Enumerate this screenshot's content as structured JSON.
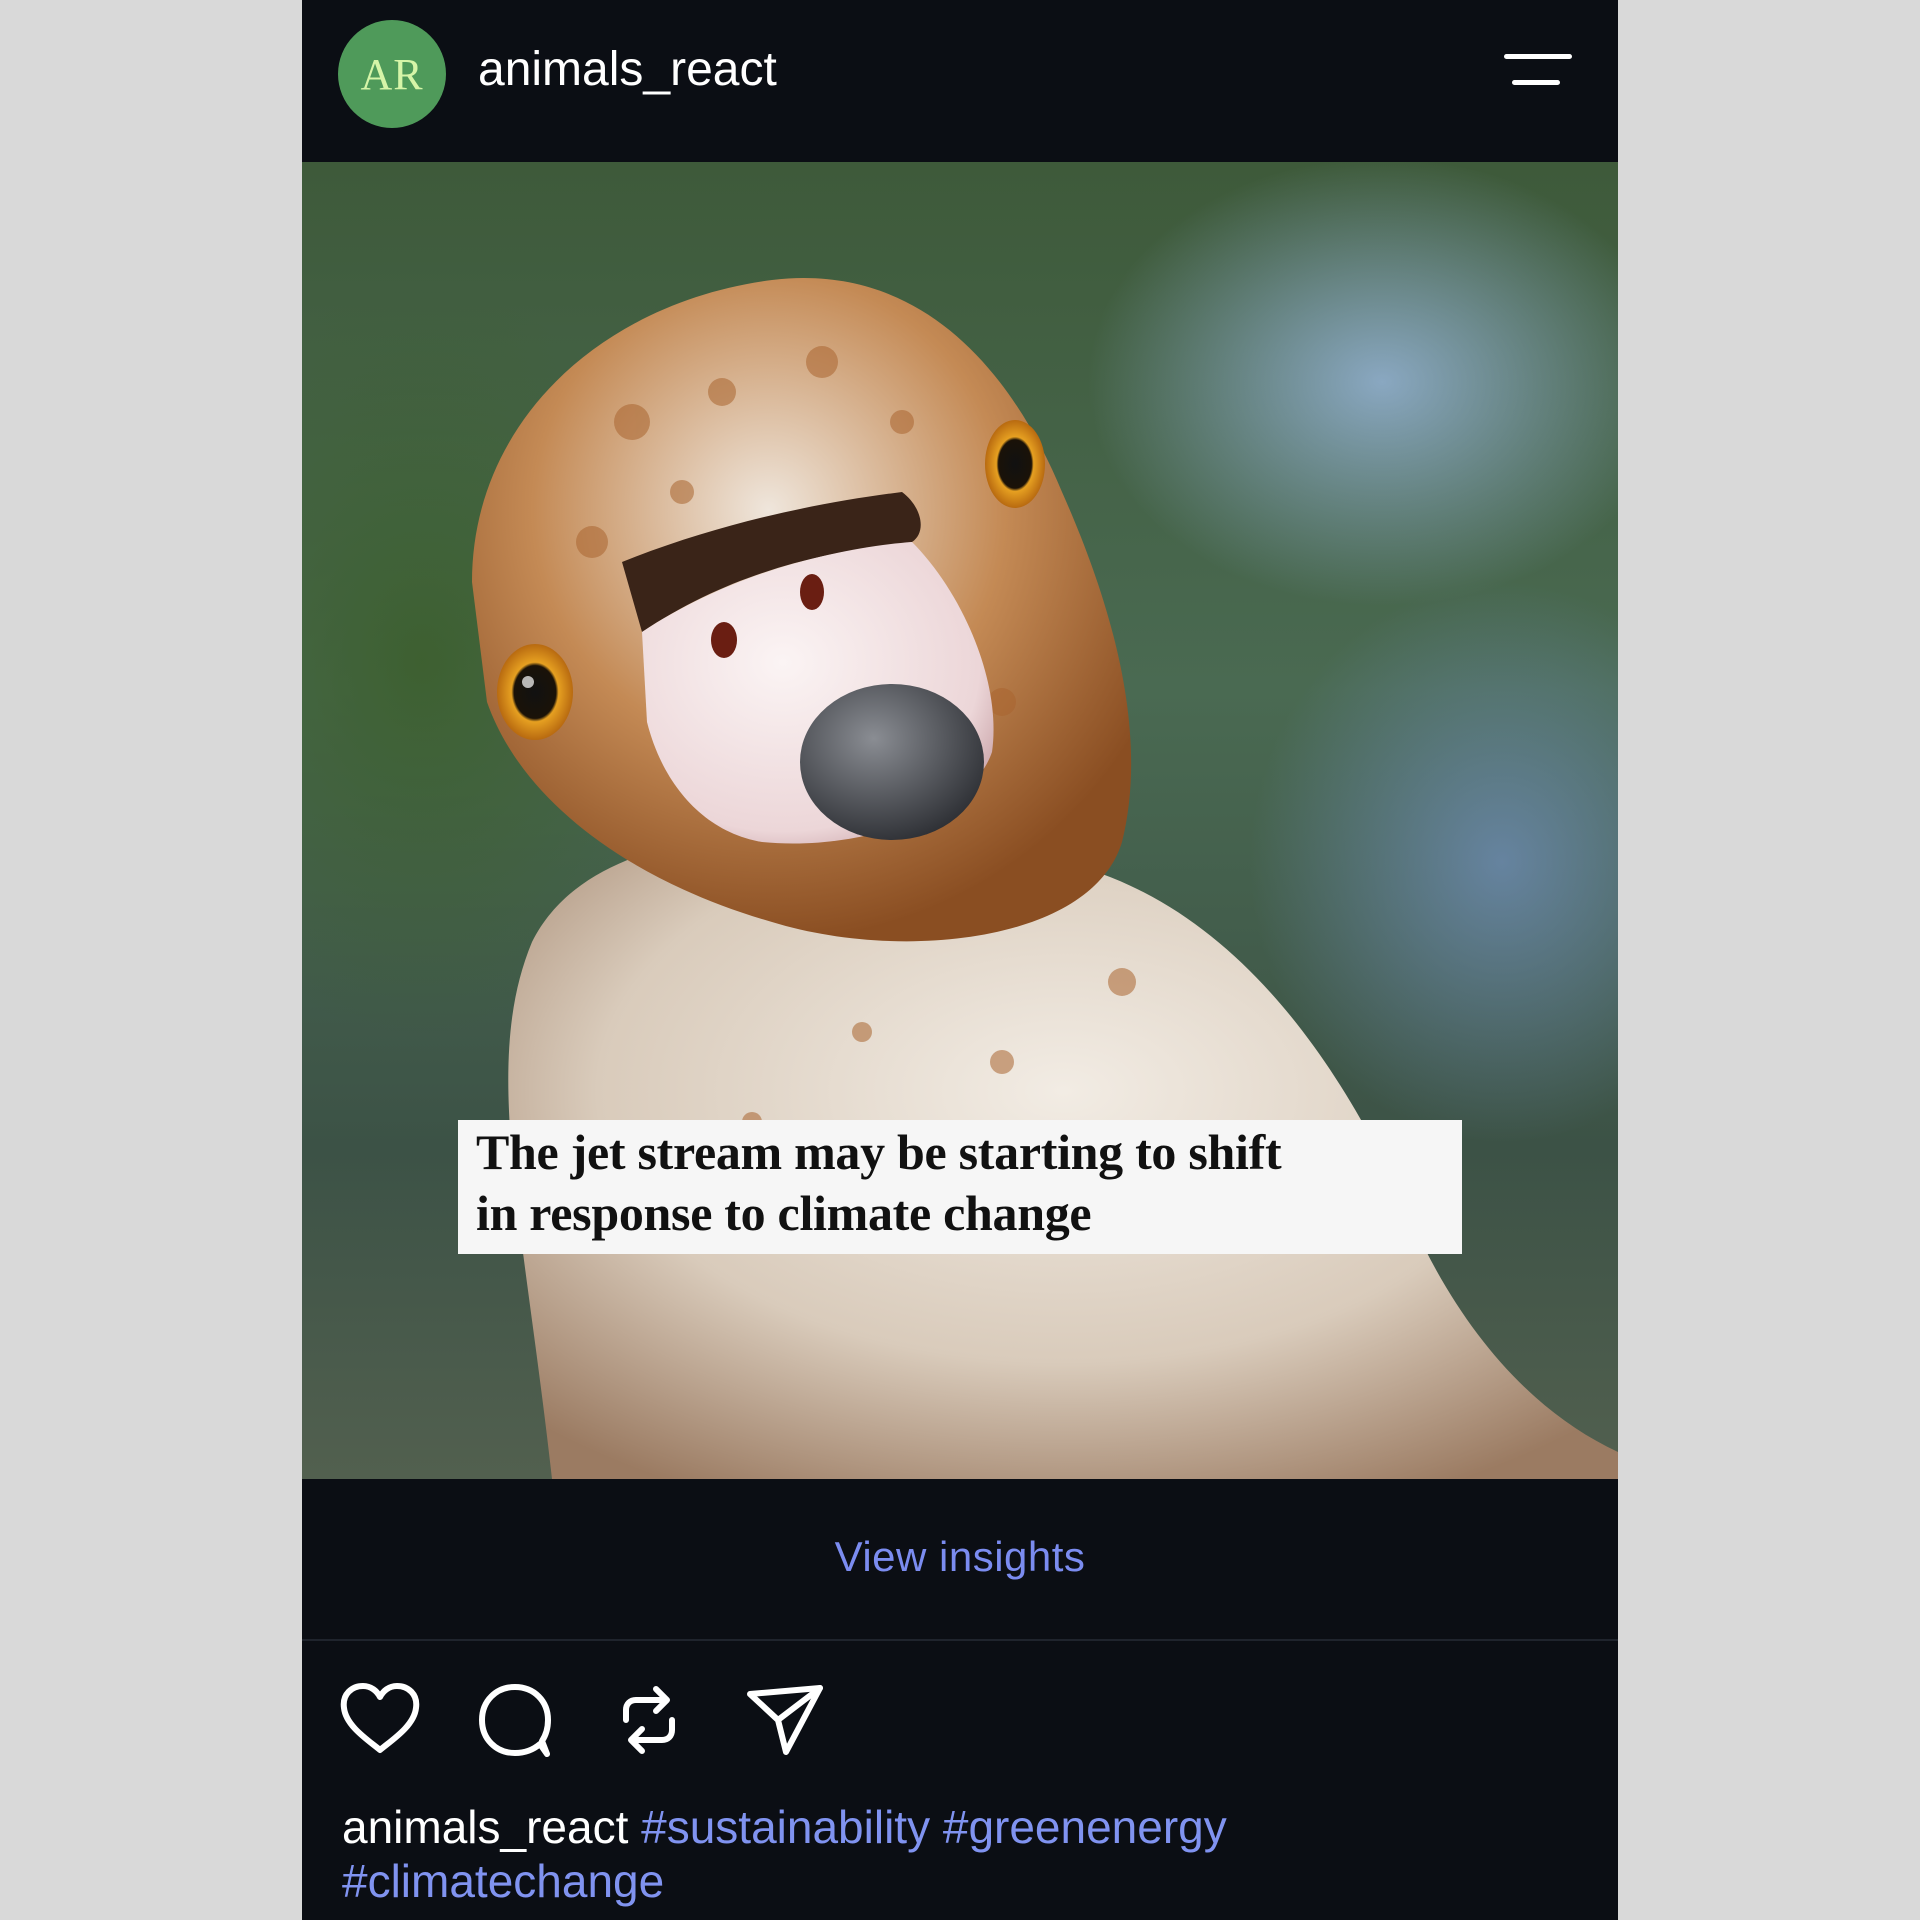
{
  "header": {
    "avatar_initials": "AR",
    "username": "animals_react",
    "menu_icon": "hamburger-menu-icon"
  },
  "post": {
    "image_subject": "goose",
    "headline_line1": "The jet stream may be starting to shift",
    "headline_line2": "in response to climate change"
  },
  "insights": {
    "label": "View insights"
  },
  "actions": [
    {
      "icon": "heart-icon"
    },
    {
      "icon": "comment-icon"
    },
    {
      "icon": "repost-icon"
    },
    {
      "icon": "send-icon"
    }
  ],
  "caption": {
    "username": "animals_react",
    "hashtags": [
      "#sustainability",
      "#greenenergy",
      "#climatechange"
    ]
  },
  "colors": {
    "background": "#0b0e14",
    "accent_link": "#7b8cf0",
    "avatar": "#4f9a5a"
  }
}
